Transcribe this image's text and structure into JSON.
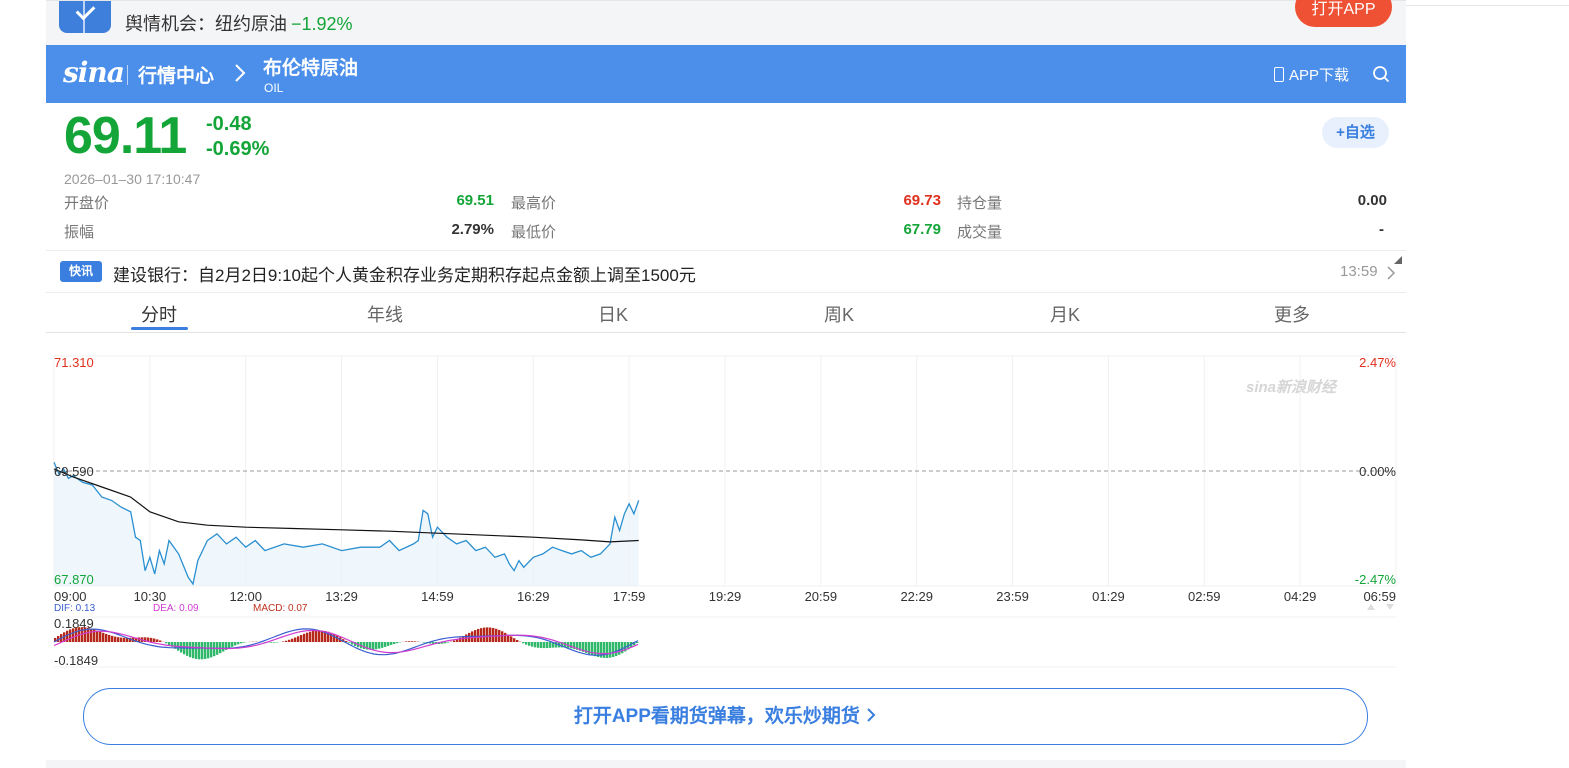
{
  "banner": {
    "title": "舆情机会：纽约原油",
    "change": "−1.92%",
    "open_button": "打开APP"
  },
  "header": {
    "logo": "sina",
    "center": "行情中心",
    "name": "布伦特原油",
    "code": "OIL",
    "app_download": "APP下载"
  },
  "quote": {
    "price": "69.11",
    "change": "-0.48",
    "change_pct": "-0.69%",
    "favorite": "+自选",
    "timestamp": "2026–01–30   17:10:47",
    "stats": [
      [
        {
          "label": "开盘价",
          "value": "69.51",
          "dir": "down"
        },
        {
          "label": "最高价",
          "value": "69.73",
          "dir": "up"
        },
        {
          "label": "持仓量",
          "value": "0.00",
          "dir": "neutral"
        }
      ],
      [
        {
          "label": "振幅",
          "value": "2.79%",
          "dir": "neutral"
        },
        {
          "label": "最低价",
          "value": "67.79",
          "dir": "down"
        },
        {
          "label": "成交量",
          "value": "-",
          "dir": "neutral"
        }
      ]
    ]
  },
  "news": {
    "badge": "快讯",
    "text": "建设银行：自2月2日9:10起个人黄金积存业务定期积存起点金额上调至1500元",
    "time": "13:59"
  },
  "tabs": [
    "分时",
    "年线",
    "日K",
    "周K",
    "月K",
    "更多"
  ],
  "chart_data": {
    "type": "line",
    "watermark": "sina新浪财经",
    "y_left_labels": [
      "71.310",
      "69.590",
      "67.870"
    ],
    "y_right_labels": [
      "2.47%",
      "0.00%",
      "-2.47%"
    ],
    "ylim": [
      67.87,
      71.31
    ],
    "baseline": 69.59,
    "x_ticks": [
      "09:00",
      "10:30",
      "12:00",
      "13:29",
      "14:59",
      "16:29",
      "17:59",
      "19:29",
      "20:59",
      "22:29",
      "23:59",
      "01:29",
      "02:59",
      "04:29",
      "06:59"
    ],
    "series": [
      {
        "name": "price",
        "color": "#2a8fd0",
        "points": [
          [
            0,
            69.72
          ],
          [
            0.05,
            69.55
          ],
          [
            0.1,
            69.62
          ],
          [
            0.15,
            69.48
          ],
          [
            0.2,
            69.52
          ],
          [
            0.3,
            69.42
          ],
          [
            0.4,
            69.38
          ],
          [
            0.5,
            69.2
          ],
          [
            0.6,
            69.15
          ],
          [
            0.7,
            69.05
          ],
          [
            0.8,
            68.98
          ],
          [
            0.85,
            68.6
          ],
          [
            0.9,
            68.55
          ],
          [
            0.95,
            68.1
          ],
          [
            1.0,
            68.3
          ],
          [
            1.05,
            68.05
          ],
          [
            1.1,
            68.4
          ],
          [
            1.15,
            68.2
          ],
          [
            1.2,
            68.55
          ],
          [
            1.3,
            68.35
          ],
          [
            1.4,
            68.0
          ],
          [
            1.45,
            67.9
          ],
          [
            1.5,
            68.25
          ],
          [
            1.6,
            68.55
          ],
          [
            1.7,
            68.65
          ],
          [
            1.8,
            68.5
          ],
          [
            1.9,
            68.6
          ],
          [
            2.0,
            68.45
          ],
          [
            2.1,
            68.55
          ],
          [
            2.2,
            68.4
          ],
          [
            2.4,
            68.5
          ],
          [
            2.6,
            68.45
          ],
          [
            2.8,
            68.5
          ],
          [
            3.0,
            68.4
          ],
          [
            3.2,
            68.45
          ],
          [
            3.4,
            68.45
          ],
          [
            3.5,
            68.55
          ],
          [
            3.6,
            68.4
          ],
          [
            3.75,
            68.5
          ],
          [
            3.8,
            68.55
          ],
          [
            3.85,
            69.0
          ],
          [
            3.9,
            68.95
          ],
          [
            3.95,
            68.6
          ],
          [
            4.0,
            68.75
          ],
          [
            4.1,
            68.6
          ],
          [
            4.2,
            68.5
          ],
          [
            4.3,
            68.55
          ],
          [
            4.4,
            68.4
          ],
          [
            4.5,
            68.45
          ],
          [
            4.6,
            68.3
          ],
          [
            4.7,
            68.35
          ],
          [
            4.75,
            68.2
          ],
          [
            4.8,
            68.1
          ],
          [
            4.85,
            68.25
          ],
          [
            4.9,
            68.15
          ],
          [
            5.0,
            68.3
          ],
          [
            5.1,
            68.35
          ],
          [
            5.2,
            68.45
          ],
          [
            5.3,
            68.4
          ],
          [
            5.4,
            68.35
          ],
          [
            5.5,
            68.4
          ],
          [
            5.6,
            68.3
          ],
          [
            5.7,
            68.35
          ],
          [
            5.8,
            68.5
          ],
          [
            5.85,
            68.9
          ],
          [
            5.9,
            68.7
          ],
          [
            5.95,
            68.95
          ],
          [
            6.0,
            69.1
          ],
          [
            6.05,
            68.95
          ],
          [
            6.1,
            69.15
          ]
        ]
      },
      {
        "name": "avg",
        "color": "#111111",
        "points": [
          [
            0,
            69.62
          ],
          [
            0.2,
            69.5
          ],
          [
            0.5,
            69.35
          ],
          [
            0.8,
            69.2
          ],
          [
            1.0,
            68.98
          ],
          [
            1.3,
            68.83
          ],
          [
            1.6,
            68.78
          ],
          [
            2.0,
            68.75
          ],
          [
            2.5,
            68.73
          ],
          [
            3.0,
            68.71
          ],
          [
            3.5,
            68.69
          ],
          [
            4.0,
            68.66
          ],
          [
            4.5,
            68.63
          ],
          [
            5.0,
            68.6
          ],
          [
            5.5,
            68.56
          ],
          [
            5.8,
            68.53
          ],
          [
            6.1,
            68.55
          ]
        ]
      }
    ],
    "macd": {
      "dif_label": "DIF: 0.13",
      "dea_label": "DEA: 0.09",
      "macd_label": "MACD: 0.07",
      "y_labels": [
        "0.1849",
        "-0.1849"
      ]
    }
  },
  "cta": {
    "text": "打开APP看期货弹幕，欢乐炒期货"
  }
}
